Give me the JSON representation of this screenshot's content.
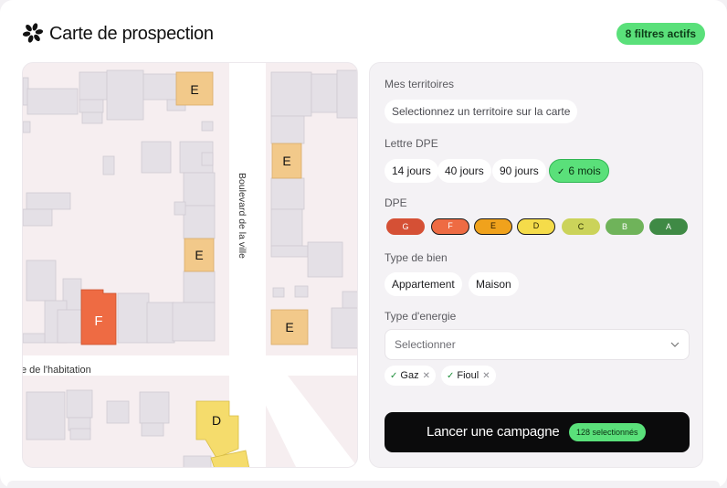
{
  "header": {
    "title": "Carte de prospection",
    "filters_badge": "8 filtres actifs",
    "logo_icon": "flower-logo-icon"
  },
  "map": {
    "street_vertical": "Boulevard de la ville",
    "street_horizontal": "e de l'habitation",
    "labels": [
      "E",
      "E",
      "E",
      "E",
      "F",
      "D"
    ],
    "colors": {
      "E": "#f2c98a",
      "F": "#ee6b43",
      "D": "#f5dc6c",
      "building": "#e4e0e6",
      "road": "#ffffff"
    }
  },
  "panel": {
    "territories": {
      "label": "Mes territoires",
      "placeholder": "Selectionnez un territoire sur la carte"
    },
    "lettre_dpe": {
      "label": "Lettre DPE",
      "options": [
        "14 jours",
        "40 jours",
        "90 jours",
        "6 mois"
      ],
      "selected": "6 mois"
    },
    "dpe": {
      "label": "DPE",
      "grades": [
        {
          "letter": "G",
          "color": "#d55035",
          "selected": false
        },
        {
          "letter": "F",
          "color": "#ee6b43",
          "selected": true
        },
        {
          "letter": "E",
          "color": "#f0a21c",
          "selected": true
        },
        {
          "letter": "D",
          "color": "#f5dc4a",
          "selected": true
        },
        {
          "letter": "C",
          "color": "#cbd35a",
          "selected": false
        },
        {
          "letter": "B",
          "color": "#6fb35a",
          "selected": false
        },
        {
          "letter": "A",
          "color": "#3f8a45",
          "selected": false
        }
      ]
    },
    "type_bien": {
      "label": "Type de bien",
      "options": [
        "Appartement",
        "Maison"
      ]
    },
    "type_energie": {
      "label": "Type d'energie",
      "placeholder": "Selectionner",
      "tags": [
        "Gaz",
        "Fioul"
      ]
    },
    "cta": {
      "label": "Lancer une campagne",
      "badge": "128 selectionnés"
    }
  }
}
